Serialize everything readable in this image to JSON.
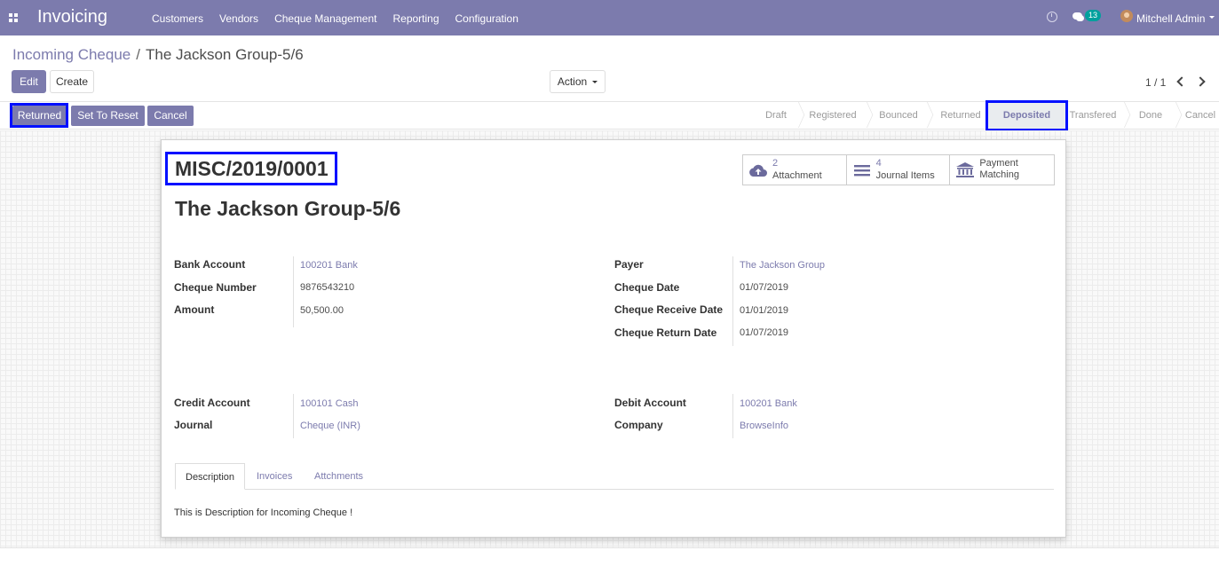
{
  "navbar": {
    "app_name": "Invoicing",
    "menu": [
      "Customers",
      "Vendors",
      "Cheque Management",
      "Reporting",
      "Configuration"
    ],
    "messages_count": "13",
    "user_name": "Mitchell Admin",
    "color": "#7c7bad"
  },
  "breadcrumb": {
    "parent": "Incoming Cheque",
    "separator": "/",
    "current": "The Jackson Group-5/6"
  },
  "control": {
    "edit_label": "Edit",
    "create_label": "Create",
    "action_label": "Action",
    "pager": "1 / 1"
  },
  "statusbar": {
    "buttons": [
      "Returned",
      "Set To Reset",
      "Cancel"
    ],
    "stages": [
      "Draft",
      "Registered",
      "Bounced",
      "Returned",
      "Deposited",
      "Transfered",
      "Done",
      "Cancel"
    ],
    "active_stage": "Deposited"
  },
  "smart_buttons": [
    {
      "count": "2",
      "label": "Attachment",
      "icon": "cloud-upload-icon"
    },
    {
      "count": "4",
      "label": "Journal Items",
      "icon": "bars-icon"
    },
    {
      "count": "",
      "label_line1": "Payment",
      "label_line2": "Matching",
      "icon": "bank-icon"
    }
  ],
  "record": {
    "name": "MISC/2019/0001",
    "title": "The Jackson Group-5/6"
  },
  "fields_left": [
    {
      "label": "Bank Account",
      "value": "100201 Bank",
      "link": true
    },
    {
      "label": "Cheque Number",
      "value": "9876543210",
      "link": false
    },
    {
      "label": "Amount",
      "value": "50,500.00",
      "link": false
    }
  ],
  "fields_right": [
    {
      "label": "Payer",
      "value": "The Jackson Group",
      "link": true
    },
    {
      "label": "Cheque Date",
      "value": "01/07/2019",
      "link": false
    },
    {
      "label": "Cheque Receive Date",
      "value": "01/01/2019",
      "link": false
    },
    {
      "label": "Cheque Return Date",
      "value": "01/07/2019",
      "link": false
    }
  ],
  "fields_left2": [
    {
      "label": "Credit Account",
      "value": "100101 Cash",
      "link": true
    },
    {
      "label": "Journal",
      "value": "Cheque (INR)",
      "link": true
    }
  ],
  "fields_right2": [
    {
      "label": "Debit Account",
      "value": "100201 Bank",
      "link": true
    },
    {
      "label": "Company",
      "value": "BrowseInfo",
      "link": true
    }
  ],
  "tabs": [
    "Description",
    "Invoices",
    "Attchments"
  ],
  "active_tab": "Description",
  "description_text": "This is Description for Incoming Cheque !",
  "highlight_color": "#0010ff"
}
